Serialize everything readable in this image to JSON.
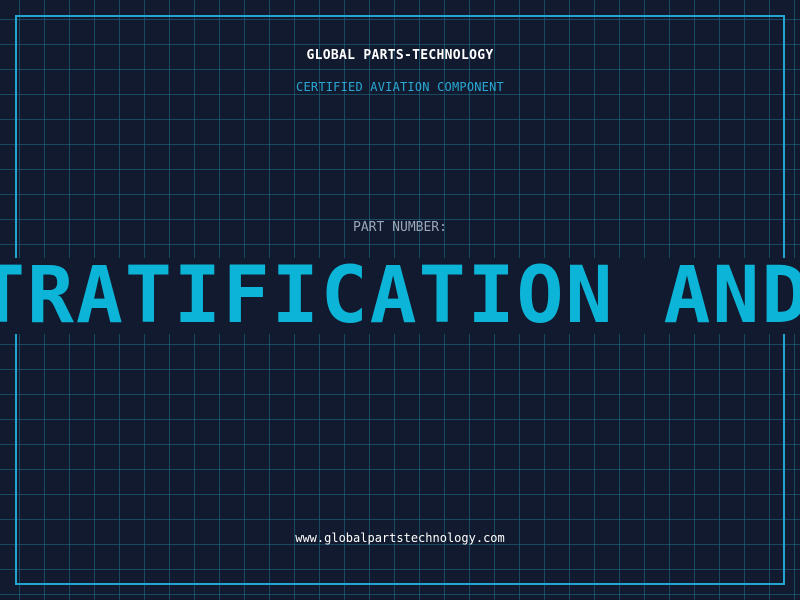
{
  "header": {
    "company": "GLOBAL PARTS-TECHNOLOGY",
    "tagline": "CERTIFIED AVIATION COMPONENT"
  },
  "part": {
    "label": "PART NUMBER:",
    "value": "TRATIFICATION AND N"
  },
  "footer": {
    "website": "www.globalpartstechnology.com"
  },
  "colors": {
    "background": "#111a2e",
    "grid": "#1f6e8a",
    "frame": "#22a6cf",
    "accent": "#0cb4d8",
    "tagline": "#2aa8d4"
  }
}
